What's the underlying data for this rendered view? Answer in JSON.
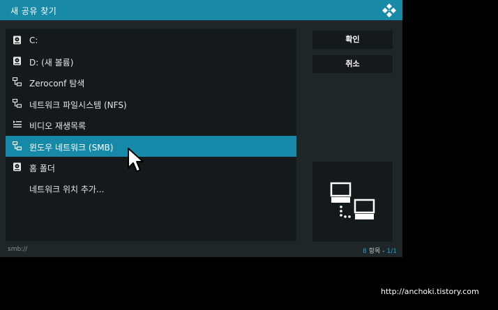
{
  "dialog": {
    "title": "새 공유 찾기",
    "logo_icon": "kodi-logo-icon"
  },
  "list": {
    "items": [
      {
        "label": "C:",
        "icon": "harddisk-icon",
        "selected": false
      },
      {
        "label": "D: (새 볼륨)",
        "icon": "harddisk-icon",
        "selected": false
      },
      {
        "label": "Zeroconf 탐색",
        "icon": "network-icon",
        "selected": false
      },
      {
        "label": "네트워크 파일시스템 (NFS)",
        "icon": "network-icon",
        "selected": false
      },
      {
        "label": "비디오 재생목록",
        "icon": "playlist-icon",
        "selected": false
      },
      {
        "label": "윈도우 네트워크 (SMB)",
        "icon": "network-icon",
        "selected": true
      },
      {
        "label": "홈 폴더",
        "icon": "harddisk-icon",
        "selected": false
      },
      {
        "label": "네트워크 위치 추가...",
        "icon": "",
        "selected": false
      }
    ]
  },
  "buttons": {
    "ok_label": "확인",
    "cancel_label": "취소"
  },
  "preview": {
    "icon": "network-computers-icon"
  },
  "status": {
    "path": "smb://",
    "count": "8",
    "items_word": "항목",
    "separator": "-",
    "page": "1/1"
  },
  "watermark": "http://anchoki.tistory.com",
  "colors": {
    "titlebar": "#1889a7",
    "selected": "#1789a8",
    "panel": "#141a1c",
    "dialog_bg": "#1e2629",
    "accent_text": "#1fa5cc"
  }
}
